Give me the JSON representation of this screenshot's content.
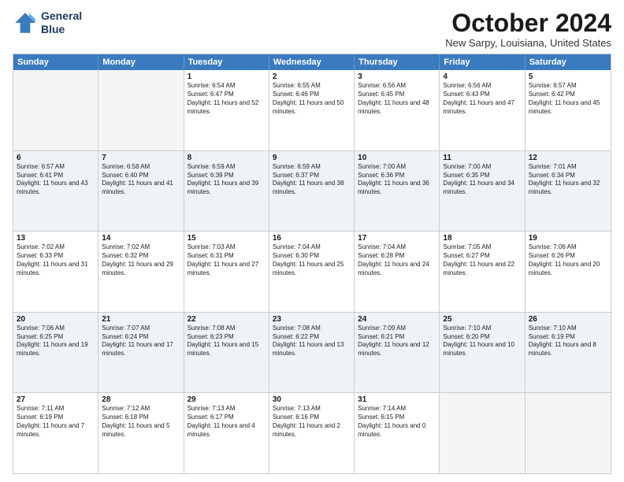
{
  "header": {
    "logo_line1": "General",
    "logo_line2": "Blue",
    "month_title": "October 2024",
    "location": "New Sarpy, Louisiana, United States"
  },
  "weekdays": [
    "Sunday",
    "Monday",
    "Tuesday",
    "Wednesday",
    "Thursday",
    "Friday",
    "Saturday"
  ],
  "rows": [
    {
      "alt": false,
      "cells": [
        {
          "day": "",
          "sunrise": "",
          "sunset": "",
          "daylight": "",
          "empty": true
        },
        {
          "day": "",
          "sunrise": "",
          "sunset": "",
          "daylight": "",
          "empty": true
        },
        {
          "day": "1",
          "sunrise": "Sunrise: 6:54 AM",
          "sunset": "Sunset: 6:47 PM",
          "daylight": "Daylight: 11 hours and 52 minutes."
        },
        {
          "day": "2",
          "sunrise": "Sunrise: 6:55 AM",
          "sunset": "Sunset: 6:46 PM",
          "daylight": "Daylight: 11 hours and 50 minutes."
        },
        {
          "day": "3",
          "sunrise": "Sunrise: 6:56 AM",
          "sunset": "Sunset: 6:45 PM",
          "daylight": "Daylight: 11 hours and 48 minutes."
        },
        {
          "day": "4",
          "sunrise": "Sunrise: 6:56 AM",
          "sunset": "Sunset: 6:43 PM",
          "daylight": "Daylight: 11 hours and 47 minutes."
        },
        {
          "day": "5",
          "sunrise": "Sunrise: 6:57 AM",
          "sunset": "Sunset: 6:42 PM",
          "daylight": "Daylight: 11 hours and 45 minutes."
        }
      ]
    },
    {
      "alt": true,
      "cells": [
        {
          "day": "6",
          "sunrise": "Sunrise: 6:57 AM",
          "sunset": "Sunset: 6:41 PM",
          "daylight": "Daylight: 11 hours and 43 minutes."
        },
        {
          "day": "7",
          "sunrise": "Sunrise: 6:58 AM",
          "sunset": "Sunset: 6:40 PM",
          "daylight": "Daylight: 11 hours and 41 minutes."
        },
        {
          "day": "8",
          "sunrise": "Sunrise: 6:59 AM",
          "sunset": "Sunset: 6:39 PM",
          "daylight": "Daylight: 11 hours and 39 minutes."
        },
        {
          "day": "9",
          "sunrise": "Sunrise: 6:59 AM",
          "sunset": "Sunset: 6:37 PM",
          "daylight": "Daylight: 11 hours and 38 minutes."
        },
        {
          "day": "10",
          "sunrise": "Sunrise: 7:00 AM",
          "sunset": "Sunset: 6:36 PM",
          "daylight": "Daylight: 11 hours and 36 minutes."
        },
        {
          "day": "11",
          "sunrise": "Sunrise: 7:00 AM",
          "sunset": "Sunset: 6:35 PM",
          "daylight": "Daylight: 11 hours and 34 minutes."
        },
        {
          "day": "12",
          "sunrise": "Sunrise: 7:01 AM",
          "sunset": "Sunset: 6:34 PM",
          "daylight": "Daylight: 11 hours and 32 minutes."
        }
      ]
    },
    {
      "alt": false,
      "cells": [
        {
          "day": "13",
          "sunrise": "Sunrise: 7:02 AM",
          "sunset": "Sunset: 6:33 PM",
          "daylight": "Daylight: 11 hours and 31 minutes."
        },
        {
          "day": "14",
          "sunrise": "Sunrise: 7:02 AM",
          "sunset": "Sunset: 6:32 PM",
          "daylight": "Daylight: 11 hours and 29 minutes."
        },
        {
          "day": "15",
          "sunrise": "Sunrise: 7:03 AM",
          "sunset": "Sunset: 6:31 PM",
          "daylight": "Daylight: 11 hours and 27 minutes."
        },
        {
          "day": "16",
          "sunrise": "Sunrise: 7:04 AM",
          "sunset": "Sunset: 6:30 PM",
          "daylight": "Daylight: 11 hours and 25 minutes."
        },
        {
          "day": "17",
          "sunrise": "Sunrise: 7:04 AM",
          "sunset": "Sunset: 6:28 PM",
          "daylight": "Daylight: 11 hours and 24 minutes."
        },
        {
          "day": "18",
          "sunrise": "Sunrise: 7:05 AM",
          "sunset": "Sunset: 6:27 PM",
          "daylight": "Daylight: 11 hours and 22 minutes."
        },
        {
          "day": "19",
          "sunrise": "Sunrise: 7:06 AM",
          "sunset": "Sunset: 6:26 PM",
          "daylight": "Daylight: 11 hours and 20 minutes."
        }
      ]
    },
    {
      "alt": true,
      "cells": [
        {
          "day": "20",
          "sunrise": "Sunrise: 7:06 AM",
          "sunset": "Sunset: 6:25 PM",
          "daylight": "Daylight: 11 hours and 19 minutes."
        },
        {
          "day": "21",
          "sunrise": "Sunrise: 7:07 AM",
          "sunset": "Sunset: 6:24 PM",
          "daylight": "Daylight: 11 hours and 17 minutes."
        },
        {
          "day": "22",
          "sunrise": "Sunrise: 7:08 AM",
          "sunset": "Sunset: 6:23 PM",
          "daylight": "Daylight: 11 hours and 15 minutes."
        },
        {
          "day": "23",
          "sunrise": "Sunrise: 7:08 AM",
          "sunset": "Sunset: 6:22 PM",
          "daylight": "Daylight: 11 hours and 13 minutes."
        },
        {
          "day": "24",
          "sunrise": "Sunrise: 7:09 AM",
          "sunset": "Sunset: 6:21 PM",
          "daylight": "Daylight: 11 hours and 12 minutes."
        },
        {
          "day": "25",
          "sunrise": "Sunrise: 7:10 AM",
          "sunset": "Sunset: 6:20 PM",
          "daylight": "Daylight: 11 hours and 10 minutes."
        },
        {
          "day": "26",
          "sunrise": "Sunrise: 7:10 AM",
          "sunset": "Sunset: 6:19 PM",
          "daylight": "Daylight: 11 hours and 8 minutes."
        }
      ]
    },
    {
      "alt": false,
      "cells": [
        {
          "day": "27",
          "sunrise": "Sunrise: 7:11 AM",
          "sunset": "Sunset: 6:19 PM",
          "daylight": "Daylight: 11 hours and 7 minutes."
        },
        {
          "day": "28",
          "sunrise": "Sunrise: 7:12 AM",
          "sunset": "Sunset: 6:18 PM",
          "daylight": "Daylight: 11 hours and 5 minutes."
        },
        {
          "day": "29",
          "sunrise": "Sunrise: 7:13 AM",
          "sunset": "Sunset: 6:17 PM",
          "daylight": "Daylight: 11 hours and 4 minutes."
        },
        {
          "day": "30",
          "sunrise": "Sunrise: 7:13 AM",
          "sunset": "Sunset: 6:16 PM",
          "daylight": "Daylight: 11 hours and 2 minutes."
        },
        {
          "day": "31",
          "sunrise": "Sunrise: 7:14 AM",
          "sunset": "Sunset: 6:15 PM",
          "daylight": "Daylight: 11 hours and 0 minutes."
        },
        {
          "day": "",
          "sunrise": "",
          "sunset": "",
          "daylight": "",
          "empty": true
        },
        {
          "day": "",
          "sunrise": "",
          "sunset": "",
          "daylight": "",
          "empty": true
        }
      ]
    }
  ]
}
